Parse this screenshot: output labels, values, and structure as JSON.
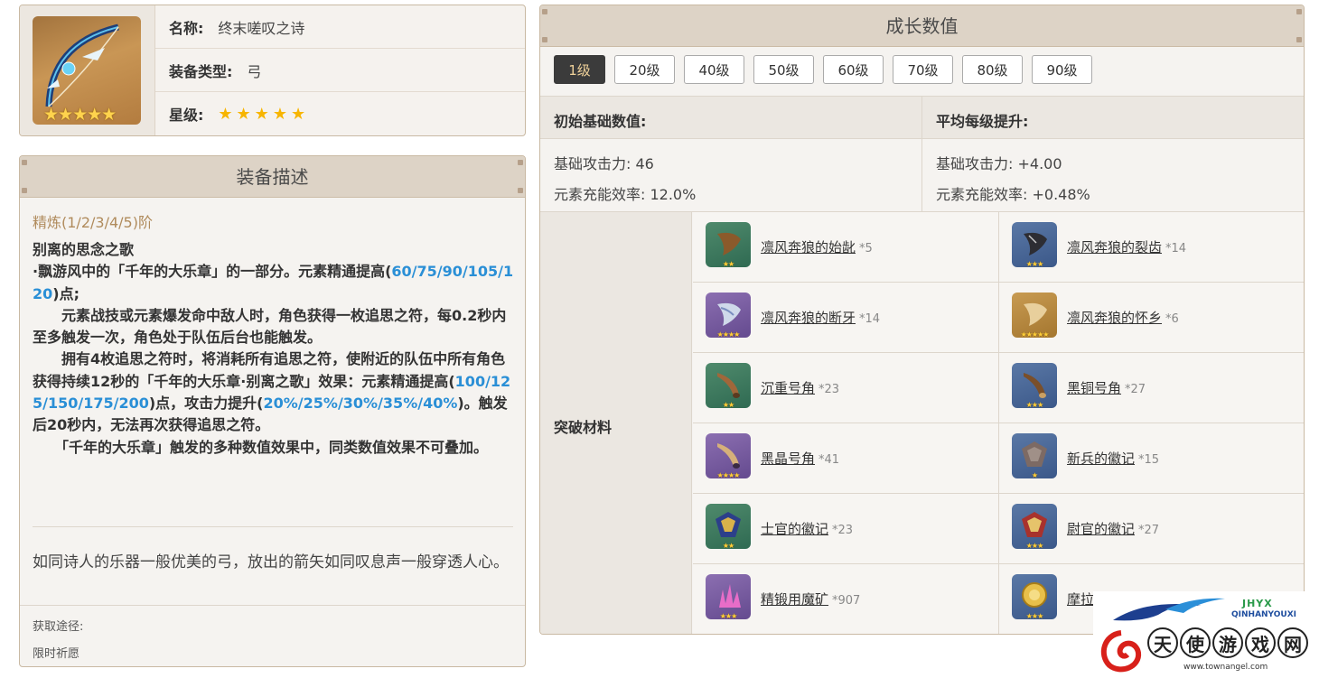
{
  "weapon": {
    "name_label": "名称:",
    "name": "终末嗟叹之诗",
    "type_label": "装备类型:",
    "type": "弓",
    "rarity_label": "星级:",
    "rarity": 5,
    "rarity_display": "★★★★★",
    "icon": "bow-icon",
    "icon_stars": "★★★★★"
  },
  "description": {
    "header": "装备描述",
    "refine_title": "精炼(1/2/3/4/5)阶",
    "skill_name": "别离的思念之歌",
    "line1_a": "·飘游风中的「千年的大乐章」的一部分。元素精通提高(",
    "line1_hl": "60/75/90/105/120",
    "line1_b": ")点;",
    "line2": "　　元素战技或元素爆发命中敌人时，角色获得一枚追思之符，每0.2秒内至多触发一次，角色处于队伍后台也能触发。",
    "line3_a": "　　拥有4枚追思之符时，将消耗所有追思之符，使附近的队伍中所有角色获得持续12秒的「千年的大乐章·别离之歌」效果：元素精通提高(",
    "line3_hl1": "100/125/150/175/200",
    "line3_b": ")点，攻击力提升(",
    "line3_hl2": "20%/25%/30%/35%/40%",
    "line3_c": ")。触发后20秒内，无法再次获得追思之符。",
    "line4": "　　「千年的大乐章」触发的多种数值效果中，同类数值效果不可叠加。",
    "flavor": "如同诗人的乐器一般优美的弓，放出的箭矢如同叹息声一般穿透人心。",
    "source_label": "获取途径:",
    "source_value": "限时祈愿"
  },
  "growth": {
    "header": "成长数值",
    "levels": [
      "1级",
      "20级",
      "40级",
      "50级",
      "60级",
      "70级",
      "80级",
      "90级"
    ],
    "active_level": "1级",
    "base_header": "初始基础数值:",
    "growth_header": "平均每级提升:",
    "base_atk": "基础攻击力: 46",
    "base_er": "元素充能效率: 12.0%",
    "inc_atk": "基础攻击力: +4.00",
    "inc_er": "元素充能效率: +0.48%",
    "materials_label": "突破材料",
    "materials": [
      {
        "name": "凛风奔狼的始龀",
        "count": "*5",
        "stars": "★★",
        "bg": "green",
        "icon": "tooth-icon"
      },
      {
        "name": "凛风奔狼的裂齿",
        "count": "*14",
        "stars": "★★★",
        "bg": "blue",
        "icon": "cracked-tooth-icon"
      },
      {
        "name": "凛风奔狼的断牙",
        "count": "*14",
        "stars": "★★★★",
        "bg": "purple",
        "icon": "broken-fang-icon"
      },
      {
        "name": "凛风奔狼的怀乡",
        "count": "*6",
        "stars": "★★★★★",
        "bg": "orange",
        "icon": "fang-icon"
      },
      {
        "name": "沉重号角",
        "count": "*23",
        "stars": "★★",
        "bg": "green",
        "icon": "horn-icon"
      },
      {
        "name": "黑铜号角",
        "count": "*27",
        "stars": "★★★",
        "bg": "blue",
        "icon": "bronze-horn-icon"
      },
      {
        "name": "黑晶号角",
        "count": "*41",
        "stars": "★★★★",
        "bg": "purple",
        "icon": "crystal-horn-icon"
      },
      {
        "name": "新兵的徽记",
        "count": "*15",
        "stars": "★",
        "bg": "blue",
        "icon": "recruit-insignia-icon"
      },
      {
        "name": "士官的徽记",
        "count": "*23",
        "stars": "★★",
        "bg": "green",
        "icon": "sergeant-insignia-icon"
      },
      {
        "name": "尉官的徽记",
        "count": "*27",
        "stars": "★★★",
        "bg": "blue",
        "icon": "lieutenant-insignia-icon"
      },
      {
        "name": "精锻用魔矿",
        "count": "*907",
        "stars": "★★★",
        "bg": "purple",
        "icon": "mystic-ore-icon"
      },
      {
        "name": "摩拉",
        "count": "",
        "stars": "★★★",
        "bg": "blue",
        "icon": "mora-icon"
      }
    ]
  },
  "watermark": {
    "brand": "JHYX",
    "brand_sub": "QINHANYOUXI",
    "chars": [
      "天",
      "使",
      "游",
      "戏",
      "网"
    ],
    "url": "www.townangel.com"
  }
}
